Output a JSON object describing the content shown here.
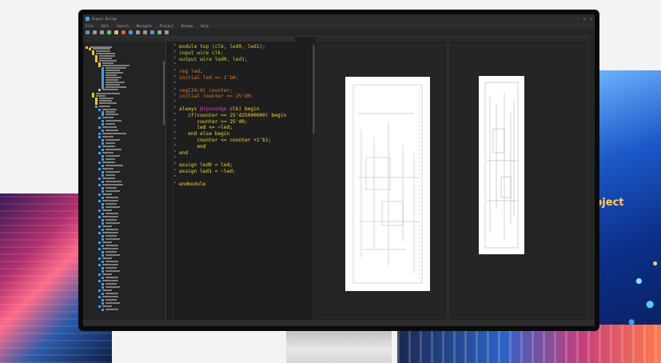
{
  "window": {
    "title": "Sigasi Design"
  },
  "menu": {
    "items": [
      "File",
      "Edit",
      "Search",
      "Navigate",
      "Project",
      "Window",
      "Help"
    ]
  },
  "editor": {
    "code_lines": [
      [
        [
          "module top (clk, led0, led1);",
          "c-kw"
        ]
      ],
      [
        [
          "input wire clk;",
          "c-g"
        ]
      ],
      [
        [
          "output wire led0, led1;",
          "c-g"
        ]
      ],
      [
        [
          "",
          ""
        ]
      ],
      [
        [
          "reg led;",
          "c-o"
        ]
      ],
      [
        [
          "initial led <= 1'b0;",
          "c-o"
        ]
      ],
      [
        [
          "",
          ""
        ]
      ],
      [
        [
          "reg[24:0] counter;",
          "c-o"
        ]
      ],
      [
        [
          "initial counter <= 25'd0;",
          "c-o"
        ]
      ],
      [
        [
          "",
          ""
        ]
      ],
      [
        [
          "always ",
          "c-y"
        ],
        [
          "@(posedge",
          "c-p"
        ],
        [
          " clk) begin",
          "c-y"
        ]
      ],
      [
        [
          "   if(counter == 25'd25000000) begin",
          "c-y"
        ]
      ],
      [
        [
          "      counter <= 25'd0;",
          "c-y"
        ]
      ],
      [
        [
          "      led <= ~led;",
          "c-y"
        ]
      ],
      [
        [
          "   end else begin",
          "c-y"
        ]
      ],
      [
        [
          "      counter <= counter +1'b1;",
          "c-y"
        ]
      ],
      [
        [
          "      end",
          "c-y"
        ]
      ],
      [
        [
          "end",
          "c-y"
        ]
      ],
      [
        [
          "",
          ""
        ]
      ],
      [
        [
          "assign led0 = led;",
          "c-y"
        ]
      ],
      [
        [
          "assign led1 = ~led;",
          "c-y"
        ]
      ],
      [
        [
          "",
          ""
        ]
      ],
      [
        [
          "endmodule",
          "c-y"
        ]
      ]
    ]
  },
  "colors": {
    "background": "#1e1e1e",
    "accent": "#3fa9f5"
  }
}
